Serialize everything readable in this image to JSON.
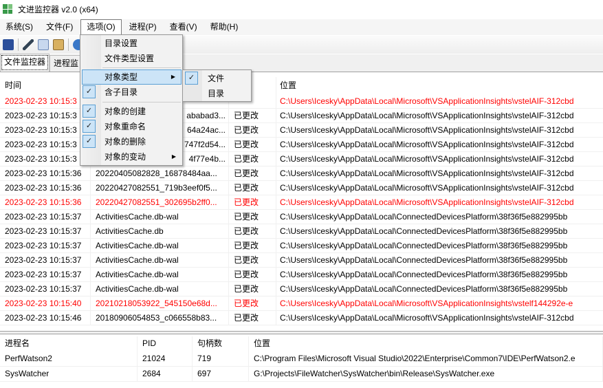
{
  "window": {
    "title": "文进监控器 v2.0 (x64)"
  },
  "menubar": [
    "系统(S)",
    "文件(F)",
    "选项(O)",
    "进程(P)",
    "查看(V)",
    "帮助(H)"
  ],
  "tabs": [
    "文件监控器",
    "进程监"
  ],
  "file_list": {
    "headers": [
      "时间",
      "位置"
    ],
    "rows": [
      {
        "time": "2023-02-23 10:15:3",
        "name": "",
        "status": "",
        "path": "C:\\Users\\Icesky\\AppData\\Local\\Microsoft\\VSApplicationInsights\\vstelAIF-312cbd",
        "red": true
      },
      {
        "time": "2023-02-23 10:15:3",
        "name": "ababad3...",
        "status": "已更改",
        "path": "C:\\Users\\Icesky\\AppData\\Local\\Microsoft\\VSApplicationInsights\\vstelAIF-312cbd",
        "red": false
      },
      {
        "time": "2023-02-23 10:15:3",
        "name": "64a24ac...",
        "status": "已更改",
        "path": "C:\\Users\\Icesky\\AppData\\Local\\Microsoft\\VSApplicationInsights\\vstelAIF-312cbd",
        "red": false
      },
      {
        "time": "2023-02-23 10:15:3",
        "name": "747f2d54...",
        "status": "已更改",
        "path": "C:\\Users\\Icesky\\AppData\\Local\\Microsoft\\VSApplicationInsights\\vstelAIF-312cbd",
        "red": false
      },
      {
        "time": "2023-02-23 10:15:3",
        "name": "4f77e4b...",
        "status": "已更改",
        "path": "C:\\Users\\Icesky\\AppData\\Local\\Microsoft\\VSApplicationInsights\\vstelAIF-312cbd",
        "red": false
      },
      {
        "time": "2023-02-23 10:15:36",
        "name": "20220405082828_16878484aa...",
        "status": "已更改",
        "path": "C:\\Users\\Icesky\\AppData\\Local\\Microsoft\\VSApplicationInsights\\vstelAIF-312cbd",
        "red": false
      },
      {
        "time": "2023-02-23 10:15:36",
        "name": "20220427082551_719b3eef0f5...",
        "status": "已更改",
        "path": "C:\\Users\\Icesky\\AppData\\Local\\Microsoft\\VSApplicationInsights\\vstelAIF-312cbd",
        "red": false
      },
      {
        "time": "2023-02-23 10:15:36",
        "name": "20220427082551_302695b2ff0...",
        "status": "已更改",
        "path": "C:\\Users\\Icesky\\AppData\\Local\\Microsoft\\VSApplicationInsights\\vstelAIF-312cbd",
        "red": true
      },
      {
        "time": "2023-02-23 10:15:37",
        "name": "ActivitiesCache.db-wal",
        "status": "已更改",
        "path": "C:\\Users\\Icesky\\AppData\\Local\\ConnectedDevicesPlatform\\38f36f5e882995bb",
        "red": false
      },
      {
        "time": "2023-02-23 10:15:37",
        "name": "ActivitiesCache.db",
        "status": "已更改",
        "path": "C:\\Users\\Icesky\\AppData\\Local\\ConnectedDevicesPlatform\\38f36f5e882995bb",
        "red": false
      },
      {
        "time": "2023-02-23 10:15:37",
        "name": "ActivitiesCache.db-wal",
        "status": "已更改",
        "path": "C:\\Users\\Icesky\\AppData\\Local\\ConnectedDevicesPlatform\\38f36f5e882995bb",
        "red": false
      },
      {
        "time": "2023-02-23 10:15:37",
        "name": "ActivitiesCache.db-wal",
        "status": "已更改",
        "path": "C:\\Users\\Icesky\\AppData\\Local\\ConnectedDevicesPlatform\\38f36f5e882995bb",
        "red": false
      },
      {
        "time": "2023-02-23 10:15:37",
        "name": "ActivitiesCache.db-wal",
        "status": "已更改",
        "path": "C:\\Users\\Icesky\\AppData\\Local\\ConnectedDevicesPlatform\\38f36f5e882995bb",
        "red": false
      },
      {
        "time": "2023-02-23 10:15:37",
        "name": "ActivitiesCache.db-wal",
        "status": "已更改",
        "path": "C:\\Users\\Icesky\\AppData\\Local\\ConnectedDevicesPlatform\\38f36f5e882995bb",
        "red": false
      },
      {
        "time": "2023-02-23 10:15:40",
        "name": "20210218053922_545150e68d...",
        "status": "已更改",
        "path": "C:\\Users\\Icesky\\AppData\\Local\\Microsoft\\VSApplicationInsights\\vstelf144292e-e",
        "red": true
      },
      {
        "time": "2023-02-23 10:15:46",
        "name": "20180906054853_c066558b83...",
        "status": "已更改",
        "path": "C:\\Users\\Icesky\\AppData\\Local\\Microsoft\\VSApplicationInsights\\vstelAIF-312cbd",
        "red": false
      }
    ]
  },
  "process_list": {
    "headers": [
      "进程名",
      "PID",
      "句柄数",
      "位置"
    ],
    "rows": [
      [
        "PerfWatson2",
        "21024",
        "719",
        "C:\\Program Files\\Microsoft Visual Studio\\2022\\Enterprise\\Common7\\IDE\\PerfWatson2.e"
      ],
      [
        "SysWatcher",
        "2684",
        "697",
        "G:\\Projects\\FileWatcher\\SysWatcher\\bin\\Release\\SysWatcher.exe"
      ]
    ]
  },
  "options_menu": {
    "items": [
      "目录设置",
      "文件类型设置",
      "对象类型",
      "含子目录",
      "对象的创建",
      "对象重命名",
      "对象的删除",
      "对象的变动"
    ],
    "submenu": [
      "文件",
      "目录"
    ]
  },
  "colors": {
    "highlight": "#cce4f7",
    "red": "#ff0000"
  }
}
